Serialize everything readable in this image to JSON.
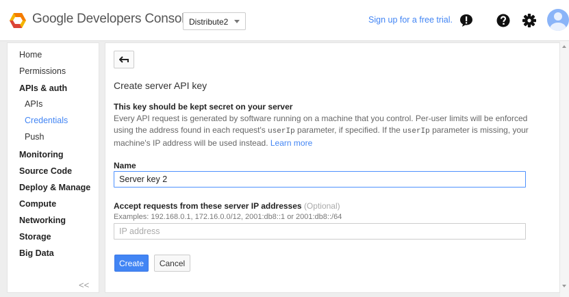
{
  "header": {
    "brand": "Google Developers Console",
    "project": "Distribute2",
    "signup": "Sign up for a free trial.",
    "icons": [
      "feedback-icon",
      "help-icon",
      "settings-icon",
      "account-avatar"
    ]
  },
  "sidebar": {
    "items": [
      {
        "label": "Home",
        "style": "normal"
      },
      {
        "label": "Permissions",
        "style": "normal"
      },
      {
        "label": "APIs & auth",
        "style": "bold"
      },
      {
        "label": "APIs",
        "style": "sub"
      },
      {
        "label": "Credentials",
        "style": "sub-active"
      },
      {
        "label": "Push",
        "style": "sub"
      },
      {
        "label": "Monitoring",
        "style": "bold"
      },
      {
        "label": "Source Code",
        "style": "bold"
      },
      {
        "label": "Deploy & Manage",
        "style": "bold"
      },
      {
        "label": "Compute",
        "style": "bold"
      },
      {
        "label": "Networking",
        "style": "bold"
      },
      {
        "label": "Storage",
        "style": "bold"
      },
      {
        "label": "Big Data",
        "style": "bold"
      }
    ],
    "collapse": "<<"
  },
  "main": {
    "title": "Create server API key",
    "section_head": "This key should be kept secret on your server",
    "desc_1": "Every API request is generated by software running on a machine that you control. Per-user limits will be enforced using the address found in each request's ",
    "desc_code_1": "userIp",
    "desc_2": " parameter, if specified. If the ",
    "desc_code_2": "userIp",
    "desc_3": " parameter is missing, your machine's IP address will be used instead. ",
    "learn_more": "Learn more",
    "name_label": "Name",
    "name_value": "Server key 2",
    "ip_label": "Accept requests from these server IP addresses",
    "ip_optional": "(Optional)",
    "examples": "Examples: 192.168.0.1, 172.16.0.0/12, 2001:db8::1 or 2001:db8::/64",
    "ip_placeholder": "IP address",
    "create": "Create",
    "cancel": "Cancel"
  },
  "colors": {
    "accent": "#4285f4",
    "logo_yellow": "#f4b400",
    "logo_orange": "#f57c00",
    "logo_red": "#db4437"
  }
}
